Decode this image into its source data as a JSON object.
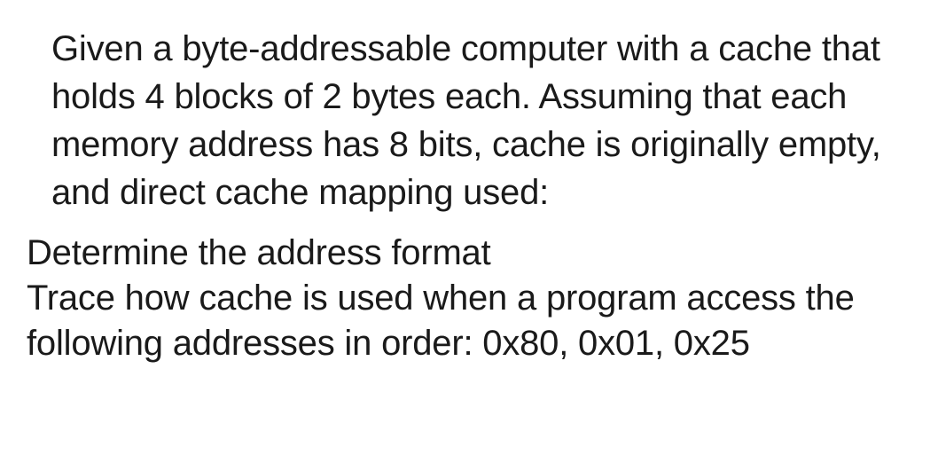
{
  "question": {
    "paragraph1": "Given a byte-addressable computer with a cache that holds 4 blocks of 2 bytes each. Assuming that each memory address has 8 bits, cache is originally empty, and direct cache mapping used:",
    "paragraph2": "Determine the address format\nTrace how cache is used when a program access the following addresses in order:  0x80, 0x01, 0x25"
  }
}
